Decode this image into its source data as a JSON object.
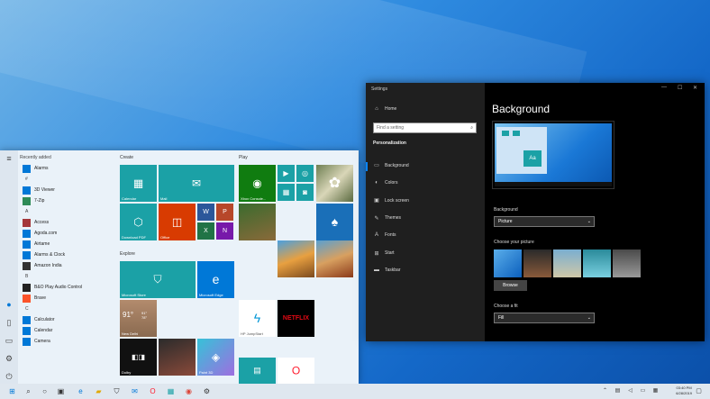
{
  "start_menu": {
    "recent_header": "Recently added",
    "apps": [
      {
        "label": "Alarms",
        "icon": "alarm-icon",
        "color": "#0078d7"
      },
      {
        "label": "#",
        "header": true
      },
      {
        "label": "3D Viewer",
        "icon": "cube-icon",
        "color": "#0078d7"
      },
      {
        "label": "7-Zip",
        "icon": "folder-icon",
        "color": "#2e8b57"
      },
      {
        "label": "A",
        "header": true
      },
      {
        "label": "Access",
        "icon": "access-icon",
        "color": "#a4373a"
      },
      {
        "label": "Agoda.com",
        "icon": "app-icon",
        "color": "#0078d7"
      },
      {
        "label": "Airtame",
        "icon": "app-icon",
        "color": "#0078d7"
      },
      {
        "label": "Alarms & Clock",
        "icon": "alarm-icon",
        "color": "#0078d7"
      },
      {
        "label": "Amazon India",
        "icon": "amazon-icon",
        "color": "#333"
      },
      {
        "label": "B",
        "header": true
      },
      {
        "label": "B&O Play Audio Control",
        "icon": "audio-icon",
        "color": "#222"
      },
      {
        "label": "Brave",
        "icon": "brave-icon",
        "color": "#fb542b"
      },
      {
        "label": "C",
        "header": true
      },
      {
        "label": "Calculator",
        "icon": "calculator-icon",
        "color": "#0078d7"
      },
      {
        "label": "Calendar",
        "icon": "calendar-icon",
        "color": "#0078d7"
      },
      {
        "label": "Camera",
        "icon": "camera-icon",
        "color": "#0078d7"
      }
    ],
    "groups": {
      "create": "Create",
      "play": "Play",
      "explore": "Explore"
    },
    "tiles": {
      "calendar": "Calendar",
      "mail": "Mail",
      "download_pdf": "Download PDF",
      "office": "Office",
      "xbox": "Xbox Console...",
      "store": "Microsoft Store",
      "edge": "Microsoft Edge",
      "weather_temp": "91°",
      "weather_hi": "91°",
      "weather_lo": "78°",
      "weather_city": "New Delhi",
      "dolby": "Dolby",
      "paint": "Paint 3D",
      "hp": "HP JumpStart",
      "netflix": "NETFLIX"
    }
  },
  "settings": {
    "window_title": "Settings",
    "home": "Home",
    "search_placeholder": "Find a setting",
    "section": "Personalization",
    "nav": [
      {
        "label": "Background",
        "icon": "picture-icon"
      },
      {
        "label": "Colors",
        "icon": "palette-icon"
      },
      {
        "label": "Lock screen",
        "icon": "lock-screen-icon"
      },
      {
        "label": "Themes",
        "icon": "brush-icon"
      },
      {
        "label": "Fonts",
        "icon": "font-icon"
      },
      {
        "label": "Start",
        "icon": "start-icon"
      },
      {
        "label": "Taskbar",
        "icon": "taskbar-icon"
      }
    ],
    "heading": "Background",
    "preview_tile": "Aa",
    "background_label": "Background",
    "background_value": "Picture",
    "choose_picture_label": "Choose your picture",
    "browse": "Browse",
    "fit_label": "Choose a fit",
    "fit_value": "Fill"
  },
  "taskbar": {
    "time": "03:40 PM",
    "date": "6/28/2019"
  }
}
